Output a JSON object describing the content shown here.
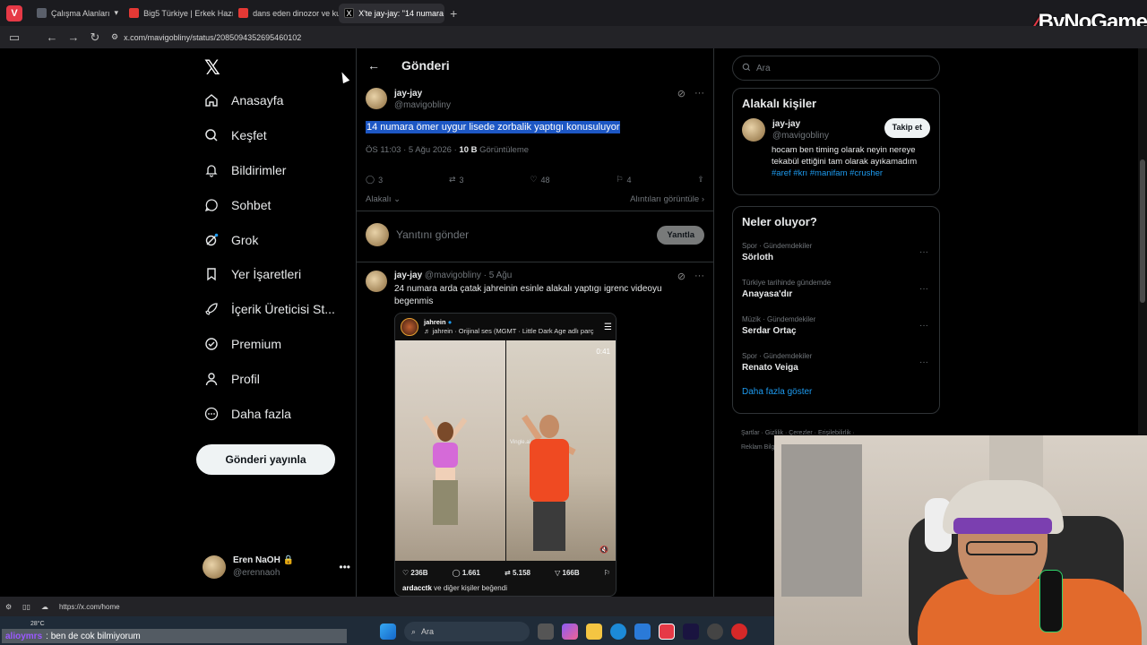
{
  "browser": {
    "tabs": [
      {
        "label": "Çalışma Alanları",
        "color": "#5a5f6a",
        "active": false
      },
      {
        "label": "Big5 Türkiye | Erkek Hazırlık",
        "color": "#e53935",
        "active": false
      },
      {
        "label": "dans eden dinozor ve kurba",
        "color": "#e53935",
        "active": false
      },
      {
        "label": "X'te jay-jay: \"14 numara ör",
        "color": "#000000",
        "active": true
      }
    ],
    "url": "x.com/mavigobliny/status/2085094352695460102",
    "status_url": "https://x.com/home"
  },
  "brand": {
    "prefix": "By",
    "name": "NoGame"
  },
  "sidebar": {
    "items": [
      {
        "label": "Anasayfa",
        "icon": "home-icon"
      },
      {
        "label": "Keşfet",
        "icon": "search-icon"
      },
      {
        "label": "Bildirimler",
        "icon": "bell-icon"
      },
      {
        "label": "Sohbet",
        "icon": "chat-icon"
      },
      {
        "label": "Grok",
        "icon": "grok-icon"
      },
      {
        "label": "Yer İşaretleri",
        "icon": "bookmark-icon"
      },
      {
        "label": "İçerik Üreticisi St...",
        "icon": "rocket-icon"
      },
      {
        "label": "Premium",
        "icon": "verified-icon"
      },
      {
        "label": "Profil",
        "icon": "person-icon"
      },
      {
        "label": "Daha fazla",
        "icon": "more-circle-icon"
      }
    ],
    "post_button": "Gönderi yayınla",
    "account": {
      "name": "Eren NaOH 🔒",
      "handle": "@erennaoh"
    }
  },
  "main": {
    "title": "Gönderi",
    "tweet": {
      "name": "jay-jay",
      "handle": "@mavigobliny",
      "text": "14 numara ömer uygur lisede zorbalik yaptıgı konusuluyor",
      "time": "ÖS 11:03 · 5 Ağu 2026 · ",
      "views": "10 B",
      "views_label": " Görüntüleme",
      "replies": "3",
      "reposts": "3",
      "likes": "48",
      "bookmarks": "4",
      "relevant": "Alakalı",
      "quotes": "Alıntıları görüntüle"
    },
    "reply_box": {
      "placeholder": "Yanıtını gönder",
      "button": "Yanıtla"
    },
    "reply_tweet": {
      "name": "jay-jay",
      "handle": "@mavigobliny",
      "date": "· 5 Ağu",
      "text": "24 numara arda çatak jahreinin esinle alakalı yaptıgı igrenc videoyu begenmis",
      "media": {
        "account": "jahrein",
        "audio": "♬ jahrein · Orijinal ses  (MGMT · Little Dark Age adlı parç",
        "duration": "0:41",
        "watermark": "Vingle.ai",
        "likes": "236B",
        "comments": "1.661",
        "reposts": "5.158",
        "shares": "166B",
        "liked_by_user": "ardacctk",
        "liked_by_rest": " ve diğer kişiler beğendi"
      }
    }
  },
  "right": {
    "search_placeholder": "Ara",
    "related_title": "Alakalı kişiler",
    "related": {
      "name": "jay-jay",
      "handle": "@mavigobliny",
      "follow": "Takip et",
      "bio": "hocam ben timing olarak neyin nereye tekabül ettiğini tam olarak ayıkamadım",
      "tags": "#aref #krı #manifam #crusher"
    },
    "trends_title": "Neler oluyor?",
    "trends": [
      {
        "category": "Spor · Gündemdekiler",
        "name": "Sörloth"
      },
      {
        "category": "Türkiye tarihinde gündemde",
        "name": "Anayasa'dır"
      },
      {
        "category": "Müzik · Gündemdekiler",
        "name": "Serdar Ortaç"
      },
      {
        "category": "Spor · Gündemdekiler",
        "name": "Renato Veiga"
      }
    ],
    "show_more": "Daha fazla göster",
    "footer_line1": "Şartlar  ·  Gizlilik  ·  Çerezler  ·  Erişilebilirlik  ·",
    "footer_line2": "Reklam Bilg"
  },
  "taskbar": {
    "weather": "28°C",
    "search": "Ara",
    "chat_user": "alioymrs",
    "chat_text": ": ben de cok bilmiyorum"
  },
  "colors": {
    "accent": "#1d9bf0",
    "highlight": "#1d57c4",
    "brand_red": "#e63946"
  }
}
